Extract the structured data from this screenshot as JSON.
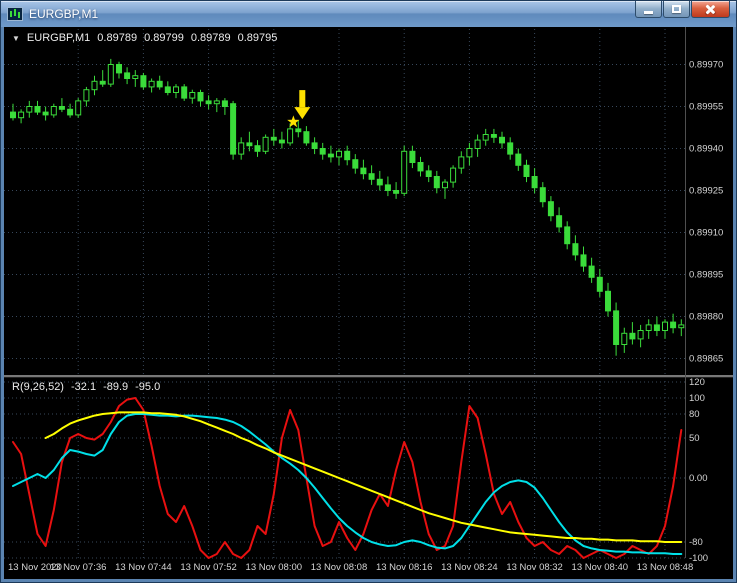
{
  "window": {
    "title": "EURGBP,M1",
    "controls": {
      "minimize": "minimize",
      "maximize": "maximize",
      "close": "close"
    }
  },
  "chart_header": {
    "toggle": "▼",
    "symbol": "EURGBP,M1",
    "open": "0.89789",
    "high": "0.89799",
    "low": "0.89789",
    "close": "0.89795"
  },
  "indicator_header": {
    "name": "R(9,26,52)",
    "value1": "-32.1",
    "value2": "-89.9",
    "value3": "-95.0"
  },
  "chart_data": [
    {
      "type": "candlestick",
      "title": "EURGBP,M1",
      "symbol": "EURGBP",
      "timeframe": "M1",
      "start_time": "07:28",
      "interval_min": 1,
      "base": 0.898,
      "point": 1e-05,
      "ylim": [
        0.89858,
        0.89984
      ],
      "colors": {
        "up": "#3BDC3B",
        "bull_fill": "#000000"
      },
      "y_axis": {
        "values": [
          0.8997,
          0.89955,
          0.8994,
          0.89925,
          0.8991,
          0.89895,
          0.8988,
          0.89865
        ],
        "texts": [
          "0.89970",
          "0.89955",
          "0.89940",
          "0.89925",
          "0.89910",
          "0.89895",
          "0.89880",
          "0.89865"
        ]
      },
      "x_labels": [
        {
          "bar": 0,
          "text": "13 Nov 2020"
        },
        {
          "bar": 8,
          "text": "13 Nov 07:36"
        },
        {
          "bar": 16,
          "text": "13 Nov 07:44"
        },
        {
          "bar": 24,
          "text": "13 Nov 07:52"
        },
        {
          "bar": 32,
          "text": "13 Nov 08:00"
        },
        {
          "bar": 40,
          "text": "13 Nov 08:08"
        },
        {
          "bar": 48,
          "text": "13 Nov 08:16"
        },
        {
          "bar": 56,
          "text": "13 Nov 08:24"
        },
        {
          "bar": 64,
          "text": "13 Nov 08:32"
        },
        {
          "bar": 72,
          "text": "13 Nov 08:40"
        },
        {
          "bar": 80,
          "text": "13 Nov 08:48"
        }
      ],
      "ohlc": [
        [
          153,
          156,
          150,
          151
        ],
        [
          151,
          154,
          149,
          153
        ],
        [
          153,
          157,
          151,
          155
        ],
        [
          155,
          157,
          152,
          153
        ],
        [
          153,
          155,
          150,
          152
        ],
        [
          152,
          156,
          151,
          155
        ],
        [
          155,
          158,
          153,
          154
        ],
        [
          154,
          156,
          151,
          152
        ],
        [
          152,
          158,
          151,
          157
        ],
        [
          157,
          162,
          155,
          161
        ],
        [
          161,
          166,
          159,
          164
        ],
        [
          164,
          168,
          162,
          163
        ],
        [
          163,
          172,
          162,
          170
        ],
        [
          170,
          171,
          165,
          167
        ],
        [
          167,
          169,
          163,
          165
        ],
        [
          165,
          168,
          162,
          166
        ],
        [
          166,
          167,
          161,
          162
        ],
        [
          162,
          165,
          160,
          164
        ],
        [
          164,
          166,
          161,
          162
        ],
        [
          162,
          164,
          159,
          160
        ],
        [
          160,
          163,
          158,
          162
        ],
        [
          162,
          163,
          157,
          158
        ],
        [
          158,
          161,
          156,
          160
        ],
        [
          160,
          161,
          155,
          157
        ],
        [
          157,
          159,
          154,
          156
        ],
        [
          156,
          158,
          153,
          157
        ],
        [
          157,
          158,
          152,
          155
        ],
        [
          156,
          157,
          136,
          138
        ],
        [
          138,
          144,
          136,
          142
        ],
        [
          142,
          146,
          139,
          141
        ],
        [
          141,
          143,
          137,
          139
        ],
        [
          139,
          145,
          138,
          144
        ],
        [
          144,
          147,
          141,
          143
        ],
        [
          143,
          146,
          140,
          142
        ],
        [
          142,
          149,
          141,
          147
        ],
        [
          147,
          150,
          144,
          146
        ],
        [
          146,
          148,
          141,
          142
        ],
        [
          142,
          144,
          138,
          140
        ],
        [
          140,
          142,
          136,
          138
        ],
        [
          138,
          141,
          135,
          137
        ],
        [
          137,
          140,
          134,
          139
        ],
        [
          139,
          141,
          134,
          136
        ],
        [
          136,
          138,
          131,
          133
        ],
        [
          133,
          136,
          129,
          131
        ],
        [
          131,
          134,
          127,
          129
        ],
        [
          129,
          132,
          125,
          127
        ],
        [
          127,
          130,
          123,
          125
        ],
        [
          125,
          128,
          122,
          124
        ],
        [
          124,
          141,
          123,
          139
        ],
        [
          139,
          141,
          133,
          135
        ],
        [
          135,
          137,
          130,
          132
        ],
        [
          132,
          134,
          128,
          130
        ],
        [
          130,
          132,
          124,
          126
        ],
        [
          126,
          129,
          122,
          128
        ],
        [
          128,
          134,
          126,
          133
        ],
        [
          133,
          139,
          131,
          137
        ],
        [
          137,
          142,
          134,
          140
        ],
        [
          140,
          145,
          137,
          143
        ],
        [
          143,
          147,
          141,
          145
        ],
        [
          145,
          147,
          142,
          144
        ],
        [
          144,
          146,
          140,
          142
        ],
        [
          142,
          144,
          136,
          138
        ],
        [
          138,
          140,
          132,
          134
        ],
        [
          134,
          136,
          128,
          130
        ],
        [
          130,
          133,
          124,
          126
        ],
        [
          126,
          128,
          119,
          121
        ],
        [
          121,
          123,
          114,
          116
        ],
        [
          116,
          119,
          110,
          112
        ],
        [
          112,
          114,
          104,
          106
        ],
        [
          106,
          109,
          100,
          102
        ],
        [
          102,
          105,
          96,
          98
        ],
        [
          98,
          101,
          92,
          94
        ],
        [
          94,
          97,
          87,
          89
        ],
        [
          89,
          92,
          80,
          82
        ],
        [
          82,
          85,
          66,
          70
        ],
        [
          70,
          76,
          67,
          74
        ],
        [
          74,
          78,
          70,
          72
        ],
        [
          72,
          77,
          69,
          75
        ],
        [
          75,
          79,
          72,
          77
        ],
        [
          77,
          80,
          73,
          75
        ],
        [
          75,
          79,
          72,
          78
        ],
        [
          78,
          81,
          74,
          76
        ],
        [
          76,
          79,
          73,
          77
        ]
      ],
      "annotations": [
        {
          "type": "arrow-down",
          "bar": 35.5,
          "price": 0.899505,
          "color": "#FFE100"
        },
        {
          "type": "star",
          "bar": 34.4,
          "price": 0.899495,
          "color": "#FFE100"
        }
      ]
    },
    {
      "type": "line",
      "name": "R(9,26,52)",
      "current_values": [
        -32.1,
        -89.9,
        -95.0
      ],
      "ylim": [
        -100,
        120
      ],
      "y_axis": {
        "values": [
          120,
          100,
          80,
          50,
          0,
          -80,
          -100
        ],
        "texts": [
          "120",
          "100",
          "80",
          "50",
          "0.00",
          "-80",
          "-100"
        ]
      },
      "series": [
        {
          "name": "R9",
          "color": "#E81010",
          "values": [
            45,
            30,
            -20,
            -70,
            -85,
            -40,
            20,
            50,
            55,
            50,
            48,
            55,
            70,
            90,
            98,
            100,
            85,
            40,
            -10,
            -45,
            -55,
            -35,
            -60,
            -90,
            -100,
            -95,
            -80,
            -95,
            -100,
            -90,
            -60,
            -70,
            -20,
            50,
            85,
            60,
            0,
            -60,
            -85,
            -80,
            -55,
            -75,
            -90,
            -70,
            -40,
            -20,
            -35,
            10,
            45,
            20,
            -30,
            -70,
            -90,
            -85,
            -60,
            20,
            90,
            75,
            30,
            -20,
            -45,
            -30,
            -55,
            -75,
            -85,
            -80,
            -90,
            -95,
            -85,
            -90,
            -100,
            -95,
            -90,
            -95,
            -100,
            -95,
            -85,
            -90,
            -95,
            -85,
            -60,
            -10,
            60
          ]
        },
        {
          "name": "R26",
          "color": "#00E0E8",
          "values": [
            -10,
            -5,
            0,
            5,
            0,
            10,
            25,
            35,
            33,
            30,
            28,
            35,
            55,
            70,
            78,
            80,
            80,
            79,
            78,
            78,
            77,
            78,
            78,
            77,
            76,
            75,
            73,
            70,
            65,
            58,
            50,
            42,
            33,
            25,
            18,
            10,
            0,
            -12,
            -25,
            -38,
            -50,
            -60,
            -68,
            -75,
            -80,
            -83,
            -85,
            -84,
            -80,
            -78,
            -80,
            -84,
            -87,
            -88,
            -85,
            -75,
            -60,
            -45,
            -30,
            -18,
            -10,
            -5,
            -3,
            -5,
            -12,
            -25,
            -40,
            -55,
            -68,
            -78,
            -85,
            -88,
            -90,
            -91,
            -92,
            -92,
            -93,
            -93,
            -94,
            -94,
            -94,
            -95,
            -95
          ]
        },
        {
          "name": "R52",
          "color": "#FFFF00",
          "values": [
            null,
            null,
            null,
            null,
            50,
            55,
            62,
            68,
            72,
            75,
            78,
            80,
            81,
            82,
            82,
            82,
            82,
            81,
            81,
            80,
            79,
            77,
            74,
            71,
            67,
            63,
            59,
            55,
            50,
            46,
            41,
            37,
            32,
            28,
            24,
            20,
            16,
            12,
            8,
            4,
            0,
            -4,
            -8,
            -12,
            -16,
            -20,
            -24,
            -28,
            -32,
            -36,
            -40,
            -44,
            -47,
            -50,
            -53,
            -56,
            -58,
            -60,
            -62,
            -64,
            -66,
            -68,
            -69,
            -70,
            -71,
            -72,
            -73,
            -74,
            -75,
            -75,
            -76,
            -76,
            -77,
            -77,
            -78,
            -78,
            -78,
            -79,
            -79,
            -79,
            -80,
            -80,
            -80
          ]
        }
      ]
    }
  ]
}
